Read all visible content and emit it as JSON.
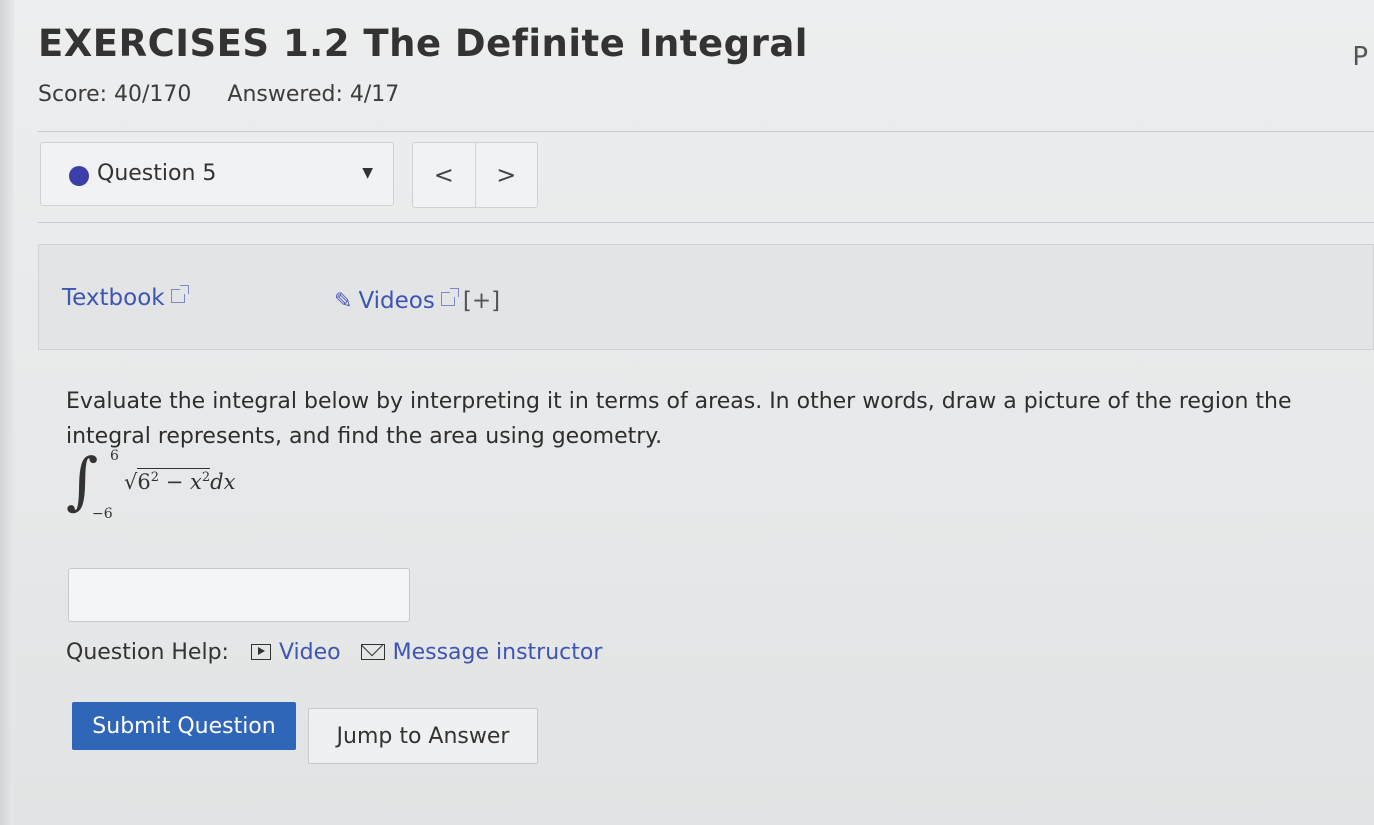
{
  "header": {
    "title": "EXERCISES 1.2 The Definite Integral",
    "corner_letter": "P",
    "score_label": "Score: 40/170",
    "answered_label": "Answered: 4/17"
  },
  "question_nav": {
    "selected": "Question 5",
    "prev_label": "<",
    "next_label": ">",
    "status_color": "#3b3fa8"
  },
  "resources": {
    "textbook_label": "Textbook",
    "videos_label": "Videos",
    "expand_label": "[+]"
  },
  "question": {
    "prompt": "Evaluate the integral below by interpreting it in terms of areas. In other words, draw a picture of the region the integral represents, and find the area using geometry.",
    "integral": {
      "upper": "6",
      "lower": "−6",
      "radicand_base": "6",
      "exp1": "2",
      "minus": " − ",
      "var": "x",
      "exp2": "2",
      "differential": "dx"
    },
    "answer_value": ""
  },
  "help": {
    "label": "Question Help:",
    "video_label": "Video",
    "message_label": "Message instructor"
  },
  "actions": {
    "submit_label": "Submit Question",
    "jump_label": "Jump to Answer"
  },
  "colors": {
    "link": "#3d55b3",
    "primary_button": "#2f66b8"
  }
}
